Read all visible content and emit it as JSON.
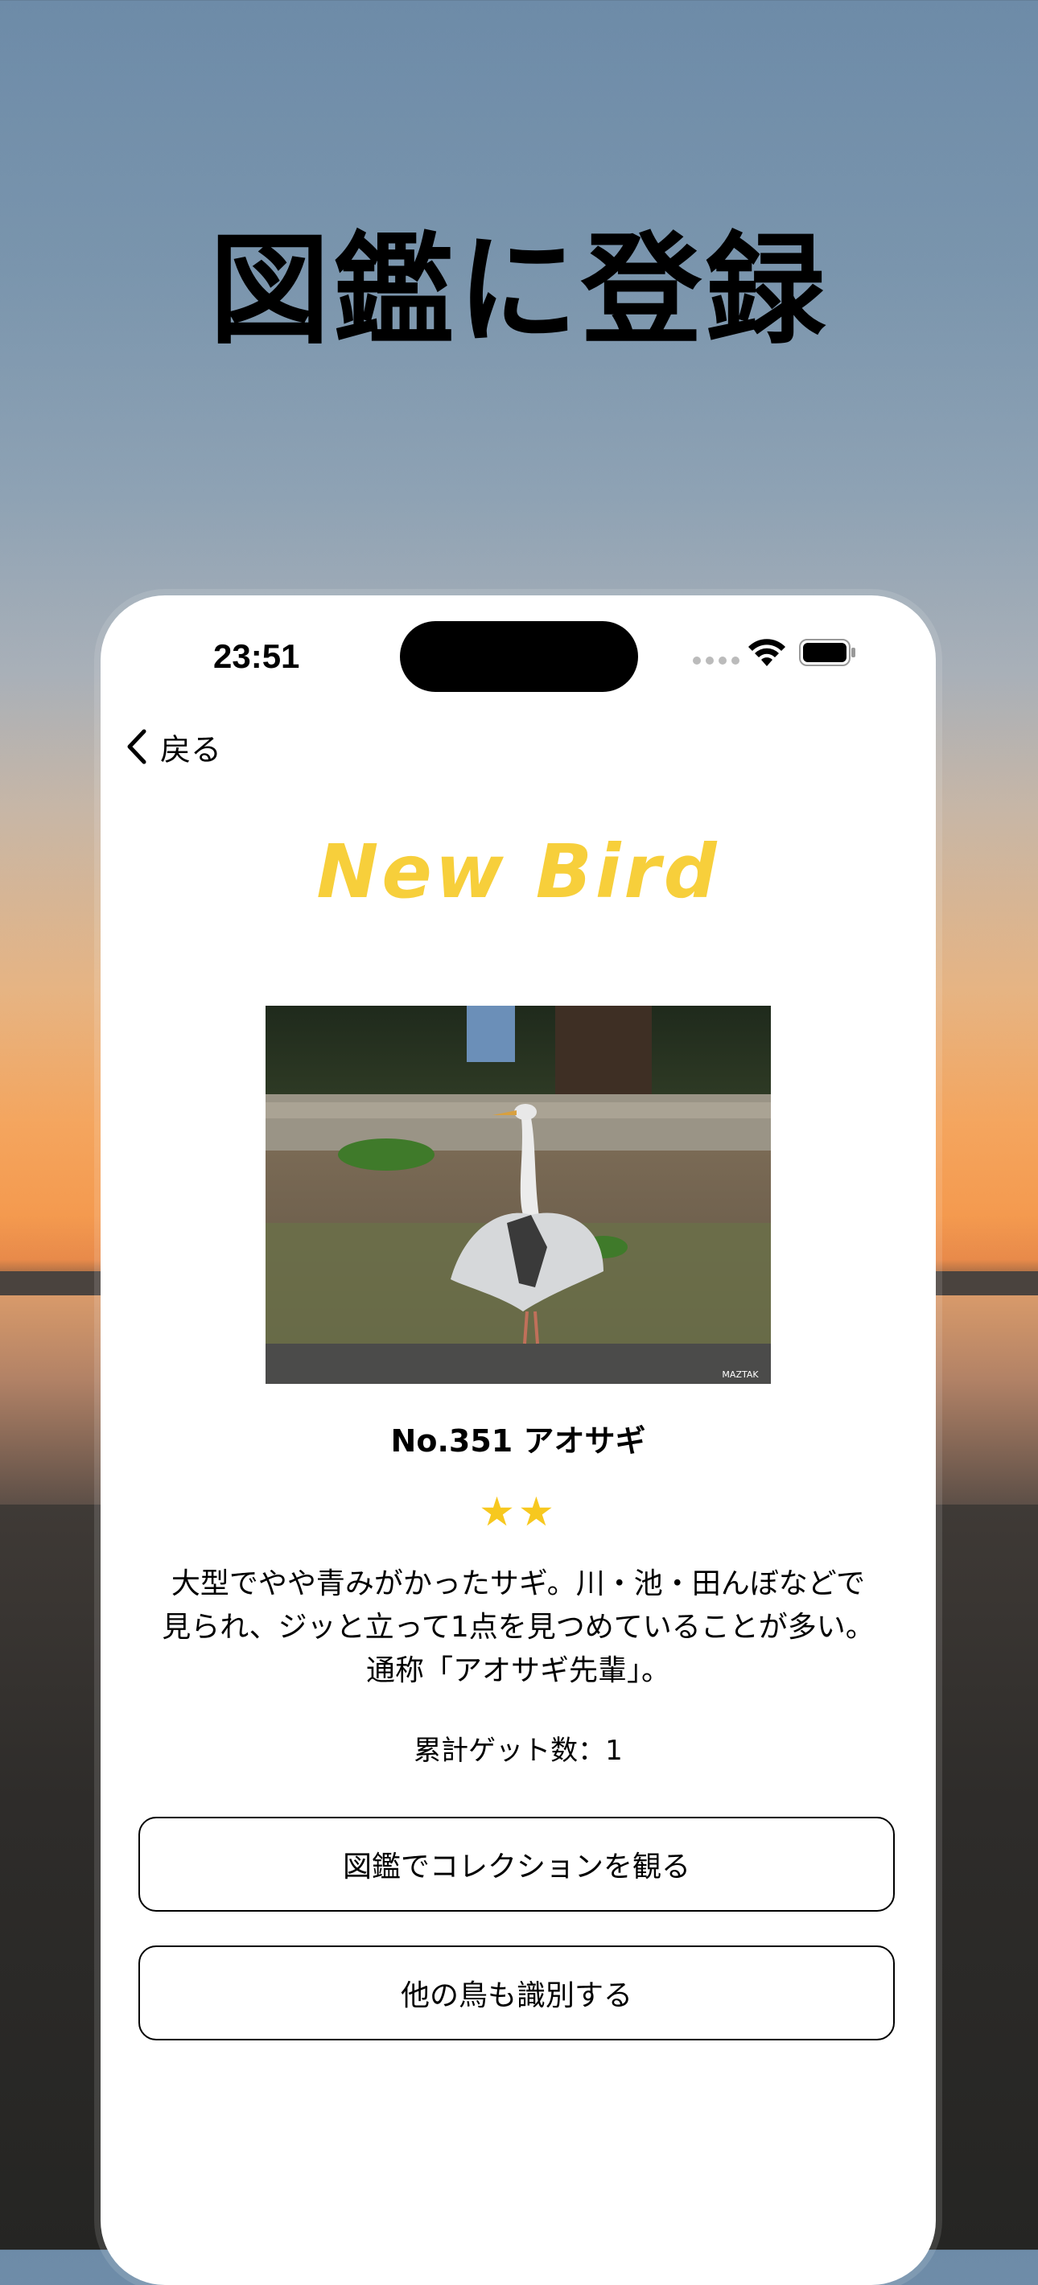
{
  "headline": "図鑑に登録",
  "status_bar": {
    "time": "23:51"
  },
  "nav": {
    "back_label": "戻る"
  },
  "result": {
    "title": "New Bird",
    "photo_watermark": "MAZTAK",
    "bird_name": "No.351 アオサギ",
    "rarity_stars": "★★",
    "rarity": 2,
    "description_lines": [
      "大型でやや青みがかったサギ。川・池・田んぼなどで",
      "見られ、ジッと立って1点を見つめていることが多い。",
      "通称「アオサギ先輩」。"
    ],
    "count_label": "累計ゲット数：1"
  },
  "buttons": {
    "collection": "図鑑でコレクションを観る",
    "identify": "他の鳥も識別する"
  },
  "colors": {
    "accent_title": "#f7cf3b",
    "star": "#f7c81f",
    "button_border": "#000000"
  }
}
